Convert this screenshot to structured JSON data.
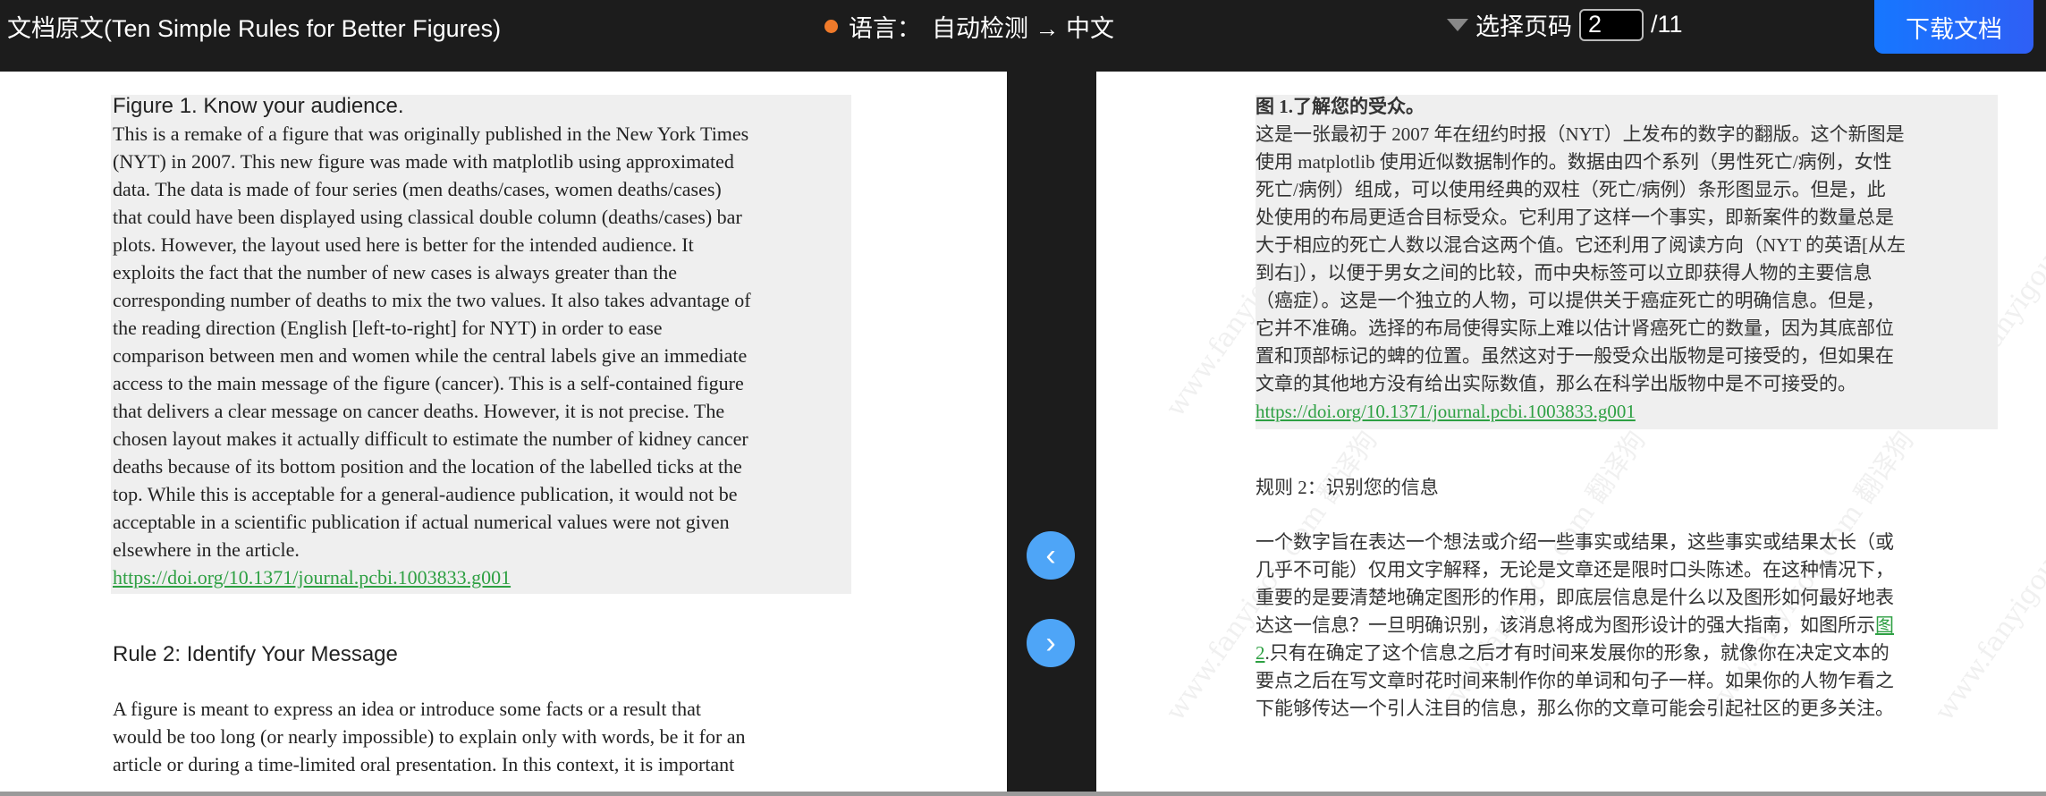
{
  "header": {
    "title": "文档原文(Ten Simple Rules for Better Figures)",
    "lang_label": "语言：",
    "lang_value": "自动检测 → 中文",
    "page_label": "选择页码",
    "page_value": "2",
    "page_total": "/11",
    "download": "下载文档",
    "accent": "#1677ff"
  },
  "nav": {
    "prev": "‹",
    "next": "›"
  },
  "left": {
    "fig_title": "Figure 1. Know your audience.",
    "fig_lines": [
      "This is a remake of a figure that was originally published in the New York Times",
      "(NYT) in 2007. This new figure was made with matplotlib using approximated",
      "data. The data is made of four series (men deaths/cases, women deaths/cases)",
      "that could have been displayed using classical double column (deaths/cases) bar",
      "plots. However, the layout used here is better for the intended audience. It",
      "exploits the fact that the number of new cases is always greater than the",
      "corresponding number of deaths to mix the two values. It also takes advantage of",
      "the reading direction (English [left-to-right] for NYT) in order to ease",
      "comparison between men and women while the central labels give an immediate",
      "access to the main message of the figure (cancer). This is a self-contained figure",
      "that delivers a clear message on cancer deaths. However, it is not precise. The",
      "chosen layout makes it actually difficult to estimate the number of kidney cancer",
      "deaths because of its bottom position and the location of the labelled ticks at the",
      "top. While this is acceptable for a general-audience publication, it would not be",
      "acceptable in a scientific publication if actual numerical values were not given",
      "elsewhere in the article."
    ],
    "link": "https://doi.org/10.1371/journal.pcbi.1003833.g001",
    "rule_title": "Rule 2: Identify Your Message",
    "rule_lines": [
      "A figure is meant to express an idea or introduce some facts or a result that",
      "would be too long (or nearly impossible) to explain only with words, be it for an",
      "article or during a time-limited oral presentation. In this context, it is important"
    ]
  },
  "right": {
    "fig_title": "图 1.了解您的受众。",
    "fig_lines": [
      "这是一张最初于 2007 年在纽约时报（NYT）上发布的数字的翻版。这个新图是",
      "使用 matplotlib 使用近似数据制作的。数据由四个系列（男性死亡/病例，女性",
      "死亡/病例）组成，可以使用经典的双柱（死亡/病例）条形图显示。但是，此",
      "处使用的布局更适合目标受众。它利用了这样一个事实，即新案件的数量总是",
      "大于相应的死亡人数以混合这两个值。它还利用了阅读方向（NYT 的英语[从左",
      "到右]），以便于男女之间的比较，而中央标签可以立即获得人物的主要信息",
      "（癌症）。这是一个独立的人物，可以提供关于癌症死亡的明确信息。但是，",
      "它并不准确。选择的布局使得实际上难以估计肾癌死亡的数量，因为其底部位",
      "置和顶部标记的蜱的位置。虽然这对于一般受众出版物是可接受的，但如果在",
      "文章的其他地方没有给出实际数值，那么在科学出版物中是不可接受的。"
    ],
    "link": "https://doi.org/10.1371/journal.pcbi.1003833.g001",
    "rule_title": "规则 2：识别您的信息",
    "rule_lines": [
      "一个数字旨在表达一个想法或介绍一些事实或结果，这些事实或结果太长（或",
      "几乎不可能）仅用文字解释，无论是文章还是限时口头陈述。在这种情况下，",
      "重要的是要清楚地确定图形的作用，即底层信息是什么以及图形如何最好地表"
    ],
    "rule_line4_pre": "达这一信息？一旦明确识别，该消息将成为图形设计的强大指南，如图所示",
    "rule_link1": "图",
    "rule_link2": "2",
    "rule_line5_post": ".只有在确定了这个信息之后才有时间来发展你的形象，就像你在决定文本的",
    "rule_lines_end": [
      "要点之后在写文章时花时间来制作你的单词和句子一样。如果你的人物乍看之",
      "下能够传达一个引人注目的信息，那么你的文章可能会引起社区的更多关注。"
    ],
    "watermark": "www.fanyigou.com 翻译狗"
  }
}
